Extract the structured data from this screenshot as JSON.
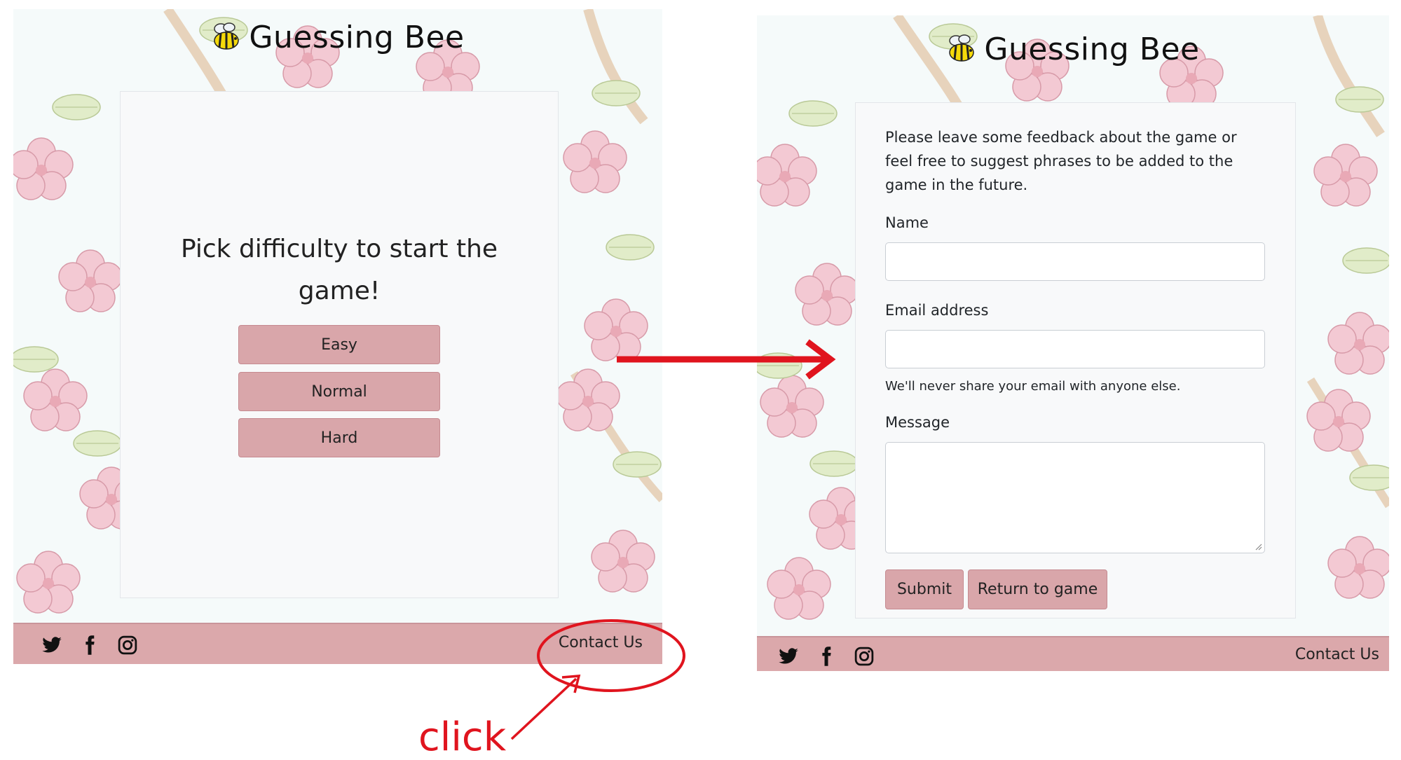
{
  "app": {
    "title": "Guessing Bee"
  },
  "start_screen": {
    "prompt": "Pick difficulty to start the game!",
    "buttons": [
      "Easy",
      "Normal",
      "Hard"
    ]
  },
  "footer": {
    "contact_label": "Contact Us",
    "social_icons": [
      "twitter-icon",
      "facebook-icon",
      "instagram-icon"
    ]
  },
  "contact_form": {
    "intro": "Please leave some feedback about the game or feel free to suggest phrases to be added to the game in the future.",
    "name_label": "Name",
    "name_value": "",
    "email_label": "Email address",
    "email_value": "",
    "email_hint": "We'll never share your email with anyone else.",
    "message_label": "Message",
    "message_value": "",
    "submit_label": "Submit",
    "return_label": "Return to game"
  },
  "annotation": {
    "click_label": "click"
  },
  "colors": {
    "accent": "#dba8ab",
    "button": "#d9a6aa",
    "card": "#f8f9fa",
    "annotation": "#e0141e"
  }
}
